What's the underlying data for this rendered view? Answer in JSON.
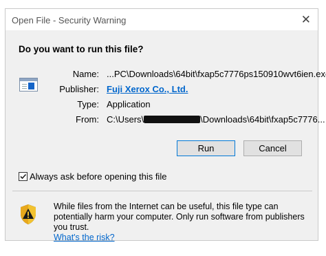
{
  "window": {
    "title": "Open File - Security Warning",
    "close_glyph": "✕"
  },
  "question": "Do you want to run this file?",
  "file_icon": "executable-file-icon",
  "fields": [
    {
      "key": "Name:",
      "value": "...PC\\Downloads\\64bit\\fxap5c7776ps150910wvt6ien.exe"
    },
    {
      "key": "Publisher:",
      "value": "Fuji Xerox Co., Ltd."
    },
    {
      "key": "Type:",
      "value": "Application"
    },
    {
      "key": "From:",
      "value_prefix": "C:\\Users\\",
      "value_suffix": "\\Downloads\\64bit\\fxap5c7776..."
    }
  ],
  "buttons": {
    "run": "Run",
    "cancel": "Cancel"
  },
  "checkbox": {
    "label": "Always ask before opening this file",
    "checked": true
  },
  "warning": {
    "icon": "warning-shield-icon",
    "text": "While files from the Internet can be useful, this file type can potentially harm your computer. Only run software from publishers you trust.",
    "link": "What's the risk?"
  },
  "colors": {
    "link": "#0066cc",
    "accent": "#0078d7"
  }
}
